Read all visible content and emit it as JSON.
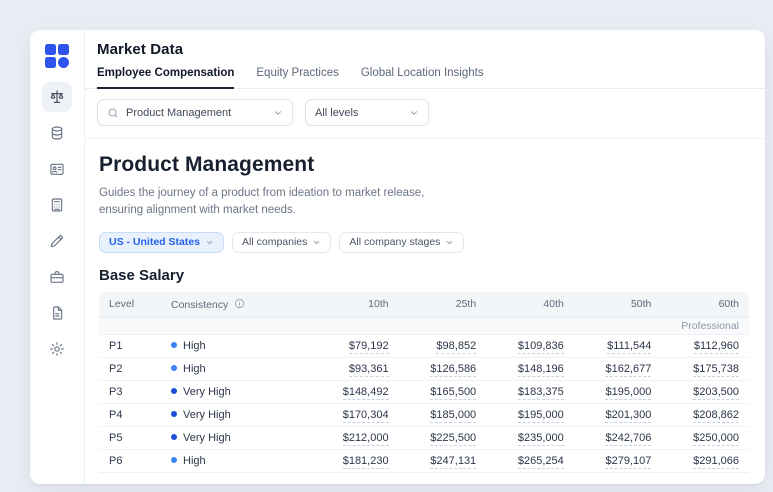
{
  "app": {
    "title": "Market Data"
  },
  "colors": {
    "accent": "#2f54eb",
    "active_chip_bg": "#e9f1fd",
    "active_chip_text": "#2563eb",
    "dot_high": "#3b82f6",
    "dot_very_high": "#1d4ed8"
  },
  "tabs": [
    {
      "label": "Employee Compensation",
      "active": true
    },
    {
      "label": "Equity Practices",
      "active": false
    },
    {
      "label": "Global Location Insights",
      "active": false
    }
  ],
  "filters": {
    "role": {
      "value": "Product Management"
    },
    "level": {
      "value": "All levels"
    }
  },
  "page": {
    "title": "Product Management",
    "description": "Guides the journey of a product from ideation to market release, ensuring alignment with market needs.",
    "chips": [
      {
        "label": "US - United States",
        "active": true
      },
      {
        "label": "All companies",
        "active": false
      },
      {
        "label": "All company stages",
        "active": false
      }
    ],
    "section": "Base Salary"
  },
  "table": {
    "columns": [
      "Level",
      "Consistency",
      "10th",
      "25th",
      "40th",
      "50th",
      "60th"
    ],
    "group": "Professional",
    "rows": [
      {
        "level": "P1",
        "consistency": "High",
        "dot_color": "#3b82f6",
        "values": [
          "$79,192",
          "$98,852",
          "$109,836",
          "$111,544",
          "$112,960"
        ]
      },
      {
        "level": "P2",
        "consistency": "High",
        "dot_color": "#3b82f6",
        "values": [
          "$93,361",
          "$126,586",
          "$148,196",
          "$162,677",
          "$175,738"
        ]
      },
      {
        "level": "P3",
        "consistency": "Very High",
        "dot_color": "#1d4ed8",
        "values": [
          "$148,492",
          "$165,500",
          "$183,375",
          "$195,000",
          "$203,500"
        ]
      },
      {
        "level": "P4",
        "consistency": "Very High",
        "dot_color": "#1d4ed8",
        "values": [
          "$170,304",
          "$185,000",
          "$195,000",
          "$201,300",
          "$208,862"
        ]
      },
      {
        "level": "P5",
        "consistency": "Very High",
        "dot_color": "#1d4ed8",
        "values": [
          "$212,000",
          "$225,500",
          "$235,000",
          "$242,706",
          "$250,000"
        ]
      },
      {
        "level": "P6",
        "consistency": "High",
        "dot_color": "#3b82f6",
        "values": [
          "$181,230",
          "$247,131",
          "$265,254",
          "$279,107",
          "$291,066"
        ]
      }
    ]
  }
}
